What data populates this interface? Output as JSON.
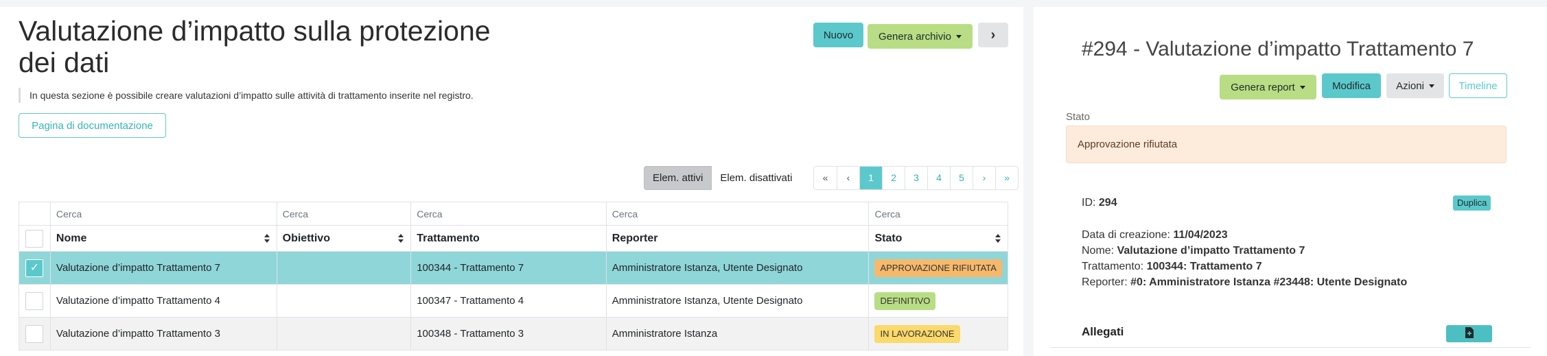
{
  "left": {
    "title": "Valutazione d’impatto sulla protezione dei dati",
    "description": "In questa sezione è possibile creare valutazioni d’impatto sulle attività di trattamento inserite nel registro.",
    "doc_button": "Pagina di documentazione",
    "toolbar": {
      "new_label": "Nuovo",
      "archive_label": "Genera archivio",
      "next_icon": "chevron-right"
    },
    "filter": {
      "active_label": "Elem. attivi",
      "inactive_label": "Elem. disattivati"
    },
    "pagination": {
      "first": "«",
      "prev": "‹",
      "pages": [
        "1",
        "2",
        "3",
        "4",
        "5"
      ],
      "current": "1",
      "next": "›",
      "last": "»"
    },
    "table": {
      "search_placeholder": "Cerca",
      "columns": [
        "Nome",
        "Obiettivo",
        "Trattamento",
        "Reporter",
        "Stato"
      ],
      "rows": [
        {
          "nome": "Valutazione d’impatto Trattamento 7",
          "obiettivo": "",
          "trattamento": "100344 - Trattamento 7",
          "reporter": "Amministratore Istanza, Utente Designato",
          "stato": "APPROVAZIONE RIFIUTATA",
          "status_color": "#f6b96c",
          "checked": true
        },
        {
          "nome": "Valutazione d’impatto Trattamento 4",
          "obiettivo": "",
          "trattamento": "100347 - Trattamento 4",
          "reporter": "Amministratore Istanza, Utente Designato",
          "stato": "DEFINITIVO",
          "status_color": "#b8dd84",
          "checked": false
        },
        {
          "nome": "Valutazione d’impatto Trattamento 3",
          "obiettivo": "",
          "trattamento": "100348 - Trattamento 3",
          "reporter": "Amministratore Istanza",
          "stato": "IN LAVORAZIONE",
          "status_color": "#fbd96a",
          "checked": false
        }
      ]
    }
  },
  "right": {
    "title": "#294 - Valutazione d’impatto Trattamento 7",
    "actions": {
      "report_label": "Genera report",
      "edit_label": "Modifica",
      "actions_label": "Azioni",
      "timeline_label": "Timeline"
    },
    "stato_label": "Stato",
    "stato_value": "Approvazione rifiutata",
    "id_label": "ID:",
    "id_value": "294",
    "duplicate_label": "Duplica",
    "created_label": "Data di creazione:",
    "created_value": "11/04/2023",
    "name_label": "Nome:",
    "name_value": "Valutazione d’impatto Trattamento 7",
    "treatment_label": "Trattamento:",
    "treatment_value": "100344: Trattamento 7",
    "reporter_label": "Reporter:",
    "reporter_value": "#0: Amministratore Istanza #23448: Utente Designato",
    "attachments_label": "Allegati",
    "attach_icon": "file-plus-icon"
  },
  "colors": {
    "accent": "#5bc9cc",
    "lime": "#b8dd84",
    "alert_bg": "#fdebdc"
  }
}
